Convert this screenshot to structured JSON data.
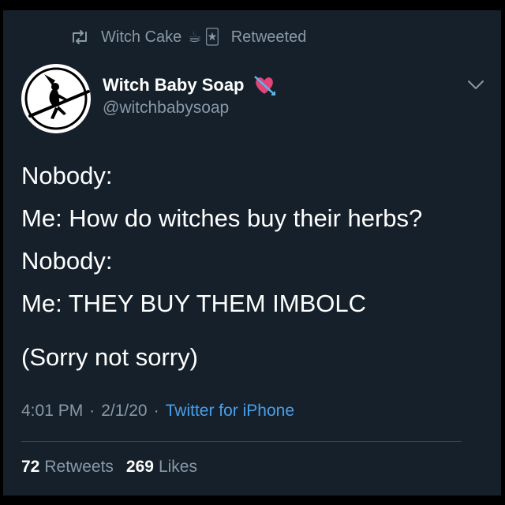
{
  "retweet": {
    "icon": "retweet-icon",
    "user": "Witch Cake",
    "emoji_1": "☕",
    "emoji_2": "🃏",
    "suffix": "Retweeted"
  },
  "author": {
    "avatar_icon": "witch-silhouette-avatar",
    "name": "Witch Baby Soap",
    "name_emoji": "heart-with-arrow-icon",
    "handle": "@witchbabysoap"
  },
  "tweet": {
    "lines": [
      "Nobody:",
      "Me: How do witches buy their herbs?",
      "Nobody:",
      "Me: THEY BUY THEM IMBOLC",
      "(Sorry not sorry)"
    ]
  },
  "meta": {
    "time": "4:01 PM",
    "separator": "·",
    "date": "2/1/20",
    "source": "Twitter for iPhone"
  },
  "stats": {
    "retweets_count": "72",
    "retweets_label": "Retweets",
    "likes_count": "269",
    "likes_label": "Likes"
  },
  "colors": {
    "background": "#15202b",
    "primary_text": "#ffffff",
    "secondary_text": "#8899a6",
    "link": "#4a9fe8",
    "divider": "#38444d"
  }
}
